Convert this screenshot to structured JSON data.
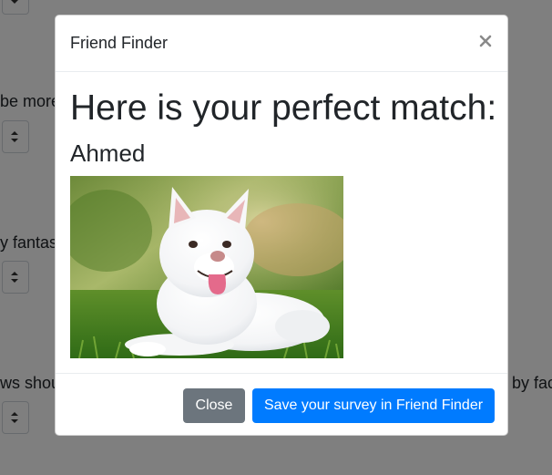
{
  "background": {
    "fragments": [
      "be more",
      "y fantas",
      "ws shou",
      "by fac"
    ]
  },
  "modal": {
    "title": "Friend Finder",
    "close_icon": "×",
    "heading": "Here is your perfect match:",
    "match_name": "Ahmed",
    "photo_description_icon": "dog-photo",
    "buttons": {
      "close_label": "Close",
      "save_label": "Save your survey in Friend Finder"
    }
  },
  "colors": {
    "overlay": "#000000",
    "primary": "#007bff",
    "secondary": "#6c757d"
  }
}
